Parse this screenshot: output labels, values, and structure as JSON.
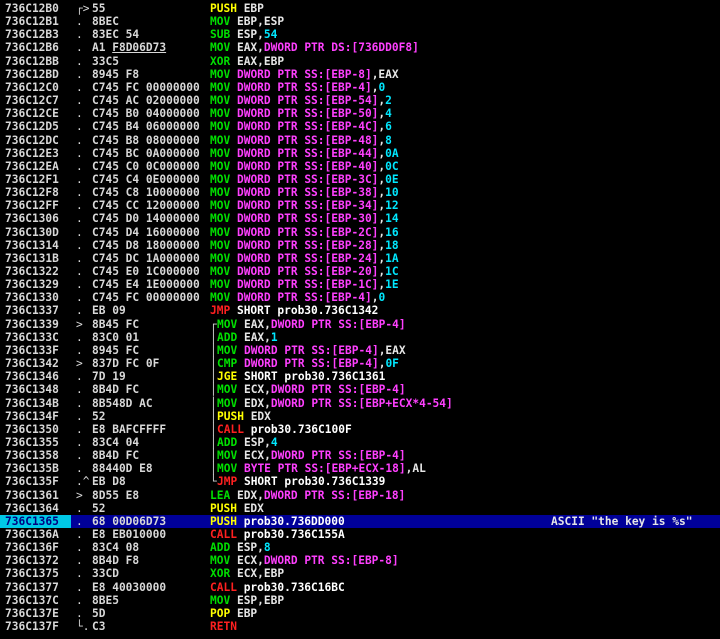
{
  "colors": {
    "background": "#000000",
    "selected_row": "#000099",
    "selected_addr": "#00c8e6",
    "mnemonic_default": "#ffff00",
    "mnemonic_arith": "#00e000",
    "mnemonic_call": "#ff2020",
    "operand_ptr": "#ff40ff",
    "operand_const": "#00e8ff"
  },
  "rows": [
    {
      "addr": "736C12B0",
      "brace": "┌>",
      "hex": "55",
      "parts": [
        [
          "PUSH",
          "m"
        ],
        [
          " EBP",
          "w"
        ]
      ]
    },
    {
      "addr": "736C12B1",
      "brace": ".",
      "hex": "8BEC",
      "parts": [
        [
          "MOV",
          "g"
        ],
        [
          " EBP,ESP",
          "w"
        ]
      ]
    },
    {
      "addr": "736C12B3",
      "brace": ".",
      "hex": "83EC 54",
      "parts": [
        [
          "SUB",
          "g"
        ],
        [
          " ESP,",
          "w"
        ],
        [
          "54",
          "c"
        ]
      ]
    },
    {
      "addr": "736C12B6",
      "brace": ".",
      "hex": "A1 F8D06D73",
      "hex_ul": "F8D06D73",
      "parts": [
        [
          "MOV",
          "g"
        ],
        [
          " EAX,",
          "w"
        ],
        [
          "DWORD PTR DS:[736DD0F8]",
          "p"
        ]
      ]
    },
    {
      "addr": "736C12BB",
      "brace": ".",
      "hex": "33C5",
      "parts": [
        [
          "XOR",
          "g"
        ],
        [
          " EAX,EBP",
          "w"
        ]
      ]
    },
    {
      "addr": "736C12BD",
      "brace": ".",
      "hex": "8945 F8",
      "parts": [
        [
          "MOV",
          "g"
        ],
        [
          " ",
          "w"
        ],
        [
          "DWORD PTR SS:[EBP-8]",
          "p"
        ],
        [
          ",EAX",
          "w"
        ]
      ]
    },
    {
      "addr": "736C12C0",
      "brace": ".",
      "hex": "C745 FC 00000000",
      "parts": [
        [
          "MOV",
          "g"
        ],
        [
          " ",
          "w"
        ],
        [
          "DWORD PTR SS:[EBP-4]",
          "p"
        ],
        [
          ",",
          "w"
        ],
        [
          "0",
          "c"
        ]
      ]
    },
    {
      "addr": "736C12C7",
      "brace": ".",
      "hex": "C745 AC 02000000",
      "parts": [
        [
          "MOV",
          "g"
        ],
        [
          " ",
          "w"
        ],
        [
          "DWORD PTR SS:[EBP-54]",
          "p"
        ],
        [
          ",",
          "w"
        ],
        [
          "2",
          "c"
        ]
      ]
    },
    {
      "addr": "736C12CE",
      "brace": ".",
      "hex": "C745 B0 04000000",
      "parts": [
        [
          "MOV",
          "g"
        ],
        [
          " ",
          "w"
        ],
        [
          "DWORD PTR SS:[EBP-50]",
          "p"
        ],
        [
          ",",
          "w"
        ],
        [
          "4",
          "c"
        ]
      ]
    },
    {
      "addr": "736C12D5",
      "brace": ".",
      "hex": "C745 B4 06000000",
      "parts": [
        [
          "MOV",
          "g"
        ],
        [
          " ",
          "w"
        ],
        [
          "DWORD PTR SS:[EBP-4C]",
          "p"
        ],
        [
          ",",
          "w"
        ],
        [
          "6",
          "c"
        ]
      ]
    },
    {
      "addr": "736C12DC",
      "brace": ".",
      "hex": "C745 B8 08000000",
      "parts": [
        [
          "MOV",
          "g"
        ],
        [
          " ",
          "w"
        ],
        [
          "DWORD PTR SS:[EBP-48]",
          "p"
        ],
        [
          ",",
          "w"
        ],
        [
          "8",
          "c"
        ]
      ]
    },
    {
      "addr": "736C12E3",
      "brace": ".",
      "hex": "C745 BC 0A000000",
      "parts": [
        [
          "MOV",
          "g"
        ],
        [
          " ",
          "w"
        ],
        [
          "DWORD PTR SS:[EBP-44]",
          "p"
        ],
        [
          ",",
          "w"
        ],
        [
          "0A",
          "c"
        ]
      ]
    },
    {
      "addr": "736C12EA",
      "brace": ".",
      "hex": "C745 C0 0C000000",
      "parts": [
        [
          "MOV",
          "g"
        ],
        [
          " ",
          "w"
        ],
        [
          "DWORD PTR SS:[EBP-40]",
          "p"
        ],
        [
          ",",
          "w"
        ],
        [
          "0C",
          "c"
        ]
      ]
    },
    {
      "addr": "736C12F1",
      "brace": ".",
      "hex": "C745 C4 0E000000",
      "parts": [
        [
          "MOV",
          "g"
        ],
        [
          " ",
          "w"
        ],
        [
          "DWORD PTR SS:[EBP-3C]",
          "p"
        ],
        [
          ",",
          "w"
        ],
        [
          "0E",
          "c"
        ]
      ]
    },
    {
      "addr": "736C12F8",
      "brace": ".",
      "hex": "C745 C8 10000000",
      "parts": [
        [
          "MOV",
          "g"
        ],
        [
          " ",
          "w"
        ],
        [
          "DWORD PTR SS:[EBP-38]",
          "p"
        ],
        [
          ",",
          "w"
        ],
        [
          "10",
          "c"
        ]
      ]
    },
    {
      "addr": "736C12FF",
      "brace": ".",
      "hex": "C745 CC 12000000",
      "parts": [
        [
          "MOV",
          "g"
        ],
        [
          " ",
          "w"
        ],
        [
          "DWORD PTR SS:[EBP-34]",
          "p"
        ],
        [
          ",",
          "w"
        ],
        [
          "12",
          "c"
        ]
      ]
    },
    {
      "addr": "736C1306",
      "brace": ".",
      "hex": "C745 D0 14000000",
      "parts": [
        [
          "MOV",
          "g"
        ],
        [
          " ",
          "w"
        ],
        [
          "DWORD PTR SS:[EBP-30]",
          "p"
        ],
        [
          ",",
          "w"
        ],
        [
          "14",
          "c"
        ]
      ]
    },
    {
      "addr": "736C130D",
      "brace": ".",
      "hex": "C745 D4 16000000",
      "parts": [
        [
          "MOV",
          "g"
        ],
        [
          " ",
          "w"
        ],
        [
          "DWORD PTR SS:[EBP-2C]",
          "p"
        ],
        [
          ",",
          "w"
        ],
        [
          "16",
          "c"
        ]
      ]
    },
    {
      "addr": "736C1314",
      "brace": ".",
      "hex": "C745 D8 18000000",
      "parts": [
        [
          "MOV",
          "g"
        ],
        [
          " ",
          "w"
        ],
        [
          "DWORD PTR SS:[EBP-28]",
          "p"
        ],
        [
          ",",
          "w"
        ],
        [
          "18",
          "c"
        ]
      ]
    },
    {
      "addr": "736C131B",
      "brace": ".",
      "hex": "C745 DC 1A000000",
      "parts": [
        [
          "MOV",
          "g"
        ],
        [
          " ",
          "w"
        ],
        [
          "DWORD PTR SS:[EBP-24]",
          "p"
        ],
        [
          ",",
          "w"
        ],
        [
          "1A",
          "c"
        ]
      ]
    },
    {
      "addr": "736C1322",
      "brace": ".",
      "hex": "C745 E0 1C000000",
      "parts": [
        [
          "MOV",
          "g"
        ],
        [
          " ",
          "w"
        ],
        [
          "DWORD PTR SS:[EBP-20]",
          "p"
        ],
        [
          ",",
          "w"
        ],
        [
          "1C",
          "c"
        ]
      ]
    },
    {
      "addr": "736C1329",
      "brace": ".",
      "hex": "C745 E4 1E000000",
      "parts": [
        [
          "MOV",
          "g"
        ],
        [
          " ",
          "w"
        ],
        [
          "DWORD PTR SS:[EBP-1C]",
          "p"
        ],
        [
          ",",
          "w"
        ],
        [
          "1E",
          "c"
        ]
      ]
    },
    {
      "addr": "736C1330",
      "brace": ".",
      "hex": "C745 FC 00000000",
      "parts": [
        [
          "MOV",
          "g"
        ],
        [
          " ",
          "w"
        ],
        [
          "DWORD PTR SS:[EBP-4]",
          "p"
        ],
        [
          ",",
          "w"
        ],
        [
          "0",
          "c"
        ]
      ]
    },
    {
      "addr": "736C1337",
      "brace": ".",
      "hex": "EB 09",
      "parts": [
        [
          "JMP",
          "r"
        ],
        [
          " SHORT prob30.736C1342",
          "cw"
        ]
      ]
    },
    {
      "addr": "736C1339",
      "brace": ">",
      "hex": "8B45 FC",
      "jbrace": "┌",
      "parts": [
        [
          "MOV",
          "g"
        ],
        [
          " EAX,",
          "w"
        ],
        [
          "DWORD PTR SS:[EBP-4]",
          "p"
        ]
      ]
    },
    {
      "addr": "736C133C",
      "brace": ".",
      "hex": "83C0 01",
      "jbrace": "│",
      "parts": [
        [
          "ADD",
          "g"
        ],
        [
          " EAX,",
          "w"
        ],
        [
          "1",
          "c"
        ]
      ]
    },
    {
      "addr": "736C133F",
      "brace": ".",
      "hex": "8945 FC",
      "jbrace": "│",
      "parts": [
        [
          "MOV",
          "g"
        ],
        [
          " ",
          "w"
        ],
        [
          "DWORD PTR SS:[EBP-4]",
          "p"
        ],
        [
          ",EAX",
          "w"
        ]
      ]
    },
    {
      "addr": "736C1342",
      "brace": ">",
      "hex": "837D FC 0F",
      "jbrace": "│",
      "parts": [
        [
          "CMP",
          "g"
        ],
        [
          " ",
          "w"
        ],
        [
          "DWORD PTR SS:[EBP-4]",
          "p"
        ],
        [
          ",",
          "w"
        ],
        [
          "0F",
          "c"
        ]
      ]
    },
    {
      "addr": "736C1346",
      "brace": ".",
      "hex": "7D 19",
      "jbrace": "│",
      "parts": [
        [
          "JGE",
          "m"
        ],
        [
          " SHORT prob30.736C1361",
          "cw"
        ]
      ]
    },
    {
      "addr": "736C1348",
      "brace": ".",
      "hex": "8B4D FC",
      "jbrace": "│",
      "parts": [
        [
          "MOV",
          "g"
        ],
        [
          " ECX,",
          "w"
        ],
        [
          "DWORD PTR SS:[EBP-4]",
          "p"
        ]
      ]
    },
    {
      "addr": "736C134B",
      "brace": ".",
      "hex": "8B548D AC",
      "jbrace": "│",
      "parts": [
        [
          "MOV",
          "g"
        ],
        [
          " EDX,",
          "w"
        ],
        [
          "DWORD PTR SS:[EBP+ECX*4-54]",
          "p"
        ]
      ]
    },
    {
      "addr": "736C134F",
      "brace": ".",
      "hex": "52",
      "jbrace": "│",
      "parts": [
        [
          "PUSH",
          "m"
        ],
        [
          " EDX",
          "w"
        ]
      ]
    },
    {
      "addr": "736C1350",
      "brace": ".",
      "hex": "E8 BAFCFFFF",
      "jbrace": "│",
      "parts": [
        [
          "CALL",
          "r"
        ],
        [
          " prob30.736C100F",
          "cw"
        ]
      ]
    },
    {
      "addr": "736C1355",
      "brace": ".",
      "hex": "83C4 04",
      "jbrace": "│",
      "parts": [
        [
          "ADD",
          "g"
        ],
        [
          " ESP,",
          "w"
        ],
        [
          "4",
          "c"
        ]
      ]
    },
    {
      "addr": "736C1358",
      "brace": ".",
      "hex": "8B4D FC",
      "jbrace": "│",
      "parts": [
        [
          "MOV",
          "g"
        ],
        [
          " ECX,",
          "w"
        ],
        [
          "DWORD PTR SS:[EBP-4]",
          "p"
        ]
      ]
    },
    {
      "addr": "736C135B",
      "brace": ".",
      "hex": "88440D E8",
      "jbrace": "│",
      "parts": [
        [
          "MOV",
          "g"
        ],
        [
          " ",
          "w"
        ],
        [
          "BYTE PTR SS:[EBP+ECX-18]",
          "p"
        ],
        [
          ",AL",
          "w"
        ]
      ]
    },
    {
      "addr": "736C135F",
      "brace": ".^",
      "hex": "EB D8",
      "jbrace": "└",
      "parts": [
        [
          "JMP",
          "r"
        ],
        [
          " SHORT prob30.736C1339",
          "cw"
        ]
      ]
    },
    {
      "addr": "736C1361",
      "brace": ">",
      "hex": "8D55 E8",
      "parts": [
        [
          "LEA",
          "g"
        ],
        [
          " EDX,",
          "w"
        ],
        [
          "DWORD PTR SS:[EBP-18]",
          "p"
        ]
      ]
    },
    {
      "addr": "736C1364",
      "brace": ".",
      "hex": "52",
      "parts": [
        [
          "PUSH",
          "m"
        ],
        [
          " EDX",
          "w"
        ]
      ]
    },
    {
      "addr": "736C1365",
      "brace": ".",
      "hex": "68 00D06D73",
      "selected": true,
      "parts": [
        [
          "PUSH",
          "m"
        ],
        [
          " prob30.736DD000",
          "cw"
        ]
      ],
      "comment": "ASCII \"the key is %s\""
    },
    {
      "addr": "736C136A",
      "brace": ".",
      "hex": "E8 EB010000",
      "parts": [
        [
          "CALL",
          "r"
        ],
        [
          " prob30.736C155A",
          "cw"
        ]
      ]
    },
    {
      "addr": "736C136F",
      "brace": ".",
      "hex": "83C4 08",
      "parts": [
        [
          "ADD",
          "g"
        ],
        [
          " ESP,",
          "w"
        ],
        [
          "8",
          "c"
        ]
      ]
    },
    {
      "addr": "736C1372",
      "brace": ".",
      "hex": "8B4D F8",
      "parts": [
        [
          "MOV",
          "g"
        ],
        [
          " ECX,",
          "w"
        ],
        [
          "DWORD PTR SS:[EBP-8]",
          "p"
        ]
      ]
    },
    {
      "addr": "736C1375",
      "brace": ".",
      "hex": "33CD",
      "parts": [
        [
          "XOR",
          "g"
        ],
        [
          " ECX,EBP",
          "w"
        ]
      ]
    },
    {
      "addr": "736C1377",
      "brace": ".",
      "hex": "E8 40030000",
      "parts": [
        [
          "CALL",
          "r"
        ],
        [
          " prob30.736C16BC",
          "cw"
        ]
      ]
    },
    {
      "addr": "736C137C",
      "brace": ".",
      "hex": "8BE5",
      "parts": [
        [
          "MOV",
          "g"
        ],
        [
          " ESP,EBP",
          "w"
        ]
      ]
    },
    {
      "addr": "736C137E",
      "brace": ".",
      "hex": "5D",
      "parts": [
        [
          "POP",
          "m"
        ],
        [
          " EBP",
          "w"
        ]
      ]
    },
    {
      "addr": "736C137F",
      "brace": "└.",
      "hex": "C3",
      "parts": [
        [
          "RETN",
          "r"
        ]
      ]
    }
  ]
}
